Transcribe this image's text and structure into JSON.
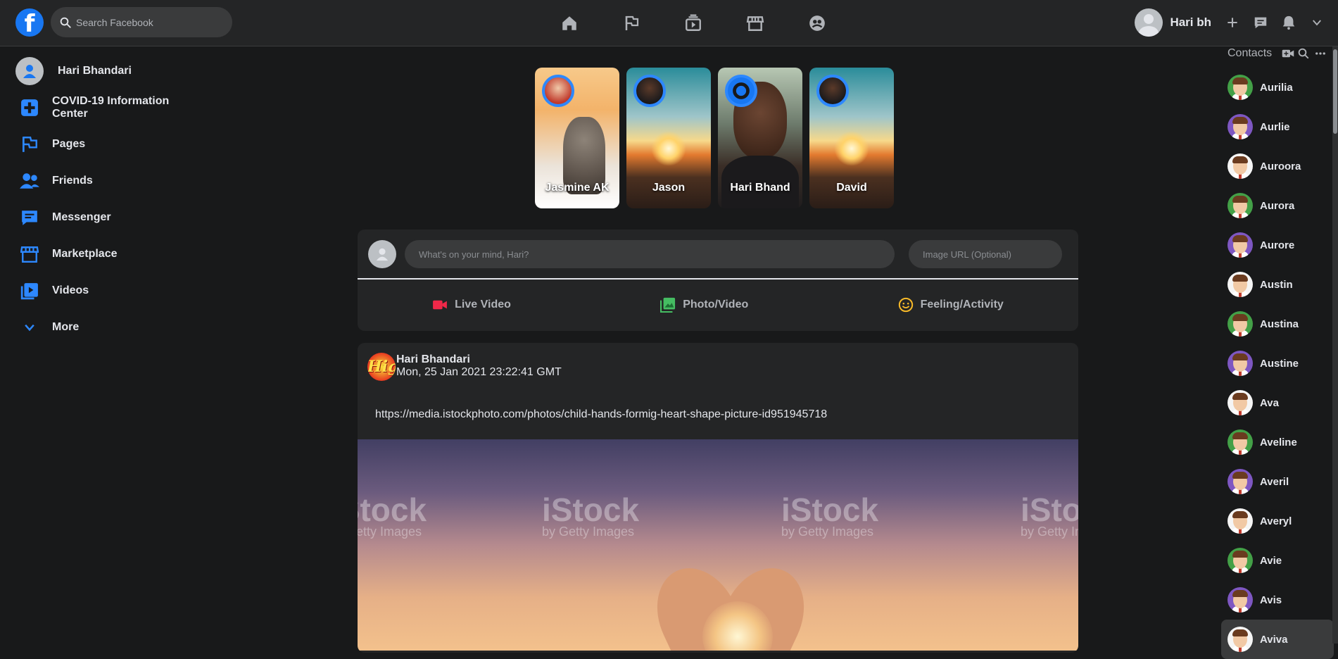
{
  "header": {
    "search_placeholder": "Search Facebook",
    "user_name": "Hari bh",
    "nav_icons": [
      "home-icon",
      "flag-icon",
      "watch-icon",
      "marketplace-icon",
      "groups-icon"
    ],
    "right_icons": [
      "plus-icon",
      "messenger-icon",
      "bell-icon",
      "caret-down-icon"
    ]
  },
  "sidebar": {
    "profile_name": "Hari Bhandari",
    "items": [
      {
        "label": "COVID-19 Information Center",
        "icon": "covid-icon"
      },
      {
        "label": "Pages",
        "icon": "flag-icon"
      },
      {
        "label": "Friends",
        "icon": "friends-icon"
      },
      {
        "label": "Messenger",
        "icon": "messenger-icon"
      },
      {
        "label": "Marketplace",
        "icon": "store-icon"
      },
      {
        "label": "Videos",
        "icon": "video-icon"
      },
      {
        "label": "More",
        "icon": "chevron-down-icon"
      }
    ]
  },
  "stories": [
    {
      "name": "Jasmine AK"
    },
    {
      "name": "Jason"
    },
    {
      "name": "Hari Bhand"
    },
    {
      "name": "David"
    }
  ],
  "composer": {
    "status_placeholder": "What's on your mind, Hari?",
    "url_placeholder": "Image URL (Optional)",
    "actions": [
      {
        "label": "Live Video",
        "color": "#f02849"
      },
      {
        "label": "Photo/Video",
        "color": "#45bd62"
      },
      {
        "label": "Feeling/Activity",
        "color": "#f7b928"
      }
    ]
  },
  "post": {
    "avatar_text": "High",
    "author": "Hari Bhandari",
    "timestamp": "Mon, 25 Jan 2021 23:22:41 GMT",
    "text": "https://media.istockphoto.com/photos/child-hands-formig-heart-shape-picture-id951945718",
    "watermark_brand": "iStock",
    "watermark_sub": "by Getty Images"
  },
  "contacts": {
    "title": "Contacts",
    "list": [
      "Aurilia",
      "Aurlie",
      "Auroora",
      "Aurora",
      "Aurore",
      "Austin",
      "Austina",
      "Austine",
      "Ava",
      "Aveline",
      "Averil",
      "Averyl",
      "Avie",
      "Avis",
      "Aviva"
    ]
  },
  "colors": {
    "accent": "#2d88ff",
    "brand": "#1877f2",
    "background": "#18191a",
    "surface": "#242526"
  }
}
